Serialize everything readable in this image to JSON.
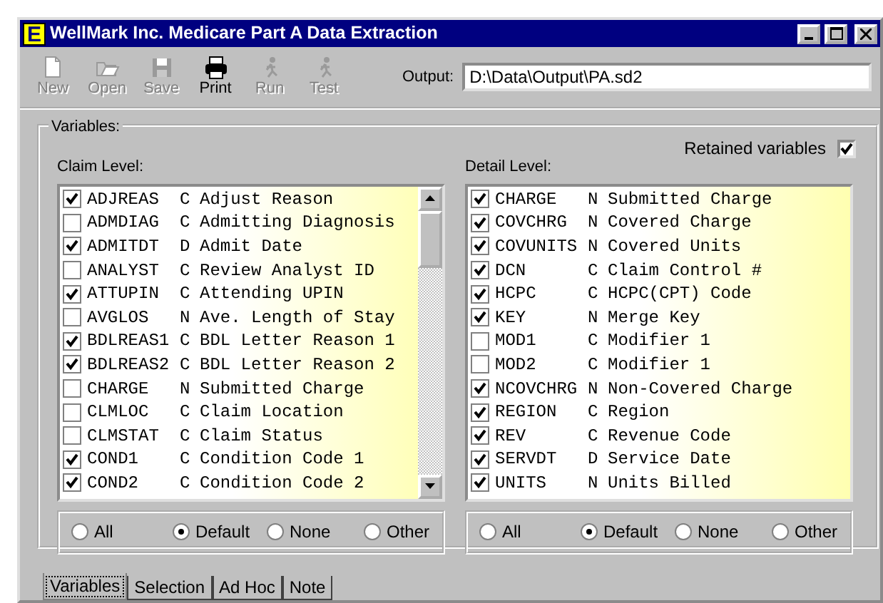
{
  "window": {
    "title": "WellMark Inc. Medicare Part A Data Extraction",
    "logo": "E"
  },
  "toolbar": [
    {
      "kind": "new",
      "label": "New",
      "disabled": true
    },
    {
      "kind": "open",
      "label": "Open",
      "disabled": true
    },
    {
      "kind": "save",
      "label": "Save",
      "disabled": true
    },
    {
      "kind": "print",
      "label": "Print",
      "disabled": false
    },
    {
      "kind": "run",
      "label": "Run",
      "disabled": true
    },
    {
      "kind": "test",
      "label": "Test",
      "disabled": true
    }
  ],
  "output": {
    "label": "Output:",
    "value": "D:\\Data\\Output\\PA.sd2"
  },
  "variables": {
    "title": "Variables:",
    "retained": {
      "label": "Retained variables",
      "checked": true
    },
    "lists": [
      {
        "label": "Claim Level:",
        "scrollbar": true,
        "rows": [
          {
            "name": "ADJREAS",
            "type": "C",
            "description": "Adjust Reason",
            "checked": true
          },
          {
            "name": "ADMDIAG",
            "type": "C",
            "description": "Admitting Diagnosis",
            "checked": false
          },
          {
            "name": "ADMITDT",
            "type": "D",
            "description": "Admit Date",
            "checked": true
          },
          {
            "name": "ANALYST",
            "type": "C",
            "description": "Review Analyst ID",
            "checked": false
          },
          {
            "name": "ATTUPIN",
            "type": "C",
            "description": "Attending UPIN",
            "checked": true
          },
          {
            "name": "AVGLOS",
            "type": "N",
            "description": "Ave. Length of Stay",
            "checked": false
          },
          {
            "name": "BDLREAS1",
            "type": "C",
            "description": "BDL Letter Reason 1",
            "checked": true
          },
          {
            "name": "BDLREAS2",
            "type": "C",
            "description": "BDL Letter Reason 2",
            "checked": true
          },
          {
            "name": "CHARGE",
            "type": "N",
            "description": "Submitted Charge",
            "checked": false
          },
          {
            "name": "CLMLOC",
            "type": "C",
            "description": "Claim Location",
            "checked": false
          },
          {
            "name": "CLMSTAT",
            "type": "C",
            "description": "Claim Status",
            "checked": false
          },
          {
            "name": "COND1",
            "type": "C",
            "description": "Condition Code 1",
            "checked": true
          },
          {
            "name": "COND2",
            "type": "C",
            "description": "Condition Code 2",
            "checked": true
          }
        ],
        "radios": [
          {
            "label": "All",
            "selected": false
          },
          {
            "label": "Default",
            "selected": true
          },
          {
            "label": "None",
            "selected": false
          },
          {
            "label": "Other",
            "selected": false
          }
        ]
      },
      {
        "label": "Detail Level:",
        "scrollbar": false,
        "rows": [
          {
            "name": "CHARGE",
            "type": "N",
            "description": "Submitted Charge",
            "checked": true
          },
          {
            "name": "COVCHRG",
            "type": "N",
            "description": "Covered Charge",
            "checked": true
          },
          {
            "name": "COVUNITS",
            "type": "N",
            "description": "Covered Units",
            "checked": true
          },
          {
            "name": "DCN",
            "type": "C",
            "description": "Claim Control #",
            "checked": true
          },
          {
            "name": "HCPC",
            "type": "C",
            "description": "HCPC(CPT) Code",
            "checked": true
          },
          {
            "name": "KEY",
            "type": "N",
            "description": "Merge Key",
            "checked": true
          },
          {
            "name": "MOD1",
            "type": "C",
            "description": "Modifier 1",
            "checked": false
          },
          {
            "name": "MOD2",
            "type": "C",
            "description": "Modifier 1",
            "checked": false
          },
          {
            "name": "NCOVCHRG",
            "type": "N",
            "description": "Non-Covered Charge",
            "checked": true
          },
          {
            "name": "REGION",
            "type": "C",
            "description": "Region",
            "checked": true
          },
          {
            "name": "REV",
            "type": "C",
            "description": "Revenue Code",
            "checked": true
          },
          {
            "name": "SERVDT",
            "type": "D",
            "description": "Service Date",
            "checked": true
          },
          {
            "name": "UNITS",
            "type": "N",
            "description": "Units Billed",
            "checked": true
          }
        ],
        "radios": [
          {
            "label": "All",
            "selected": false
          },
          {
            "label": "Default",
            "selected": true
          },
          {
            "label": "None",
            "selected": false
          },
          {
            "label": "Other",
            "selected": false
          }
        ]
      }
    ]
  },
  "tabs": [
    {
      "label": "Variables",
      "selected": true
    },
    {
      "label": "Selection",
      "selected": false
    },
    {
      "label": "Ad Hoc",
      "selected": false
    },
    {
      "label": "Note",
      "selected": false
    }
  ]
}
